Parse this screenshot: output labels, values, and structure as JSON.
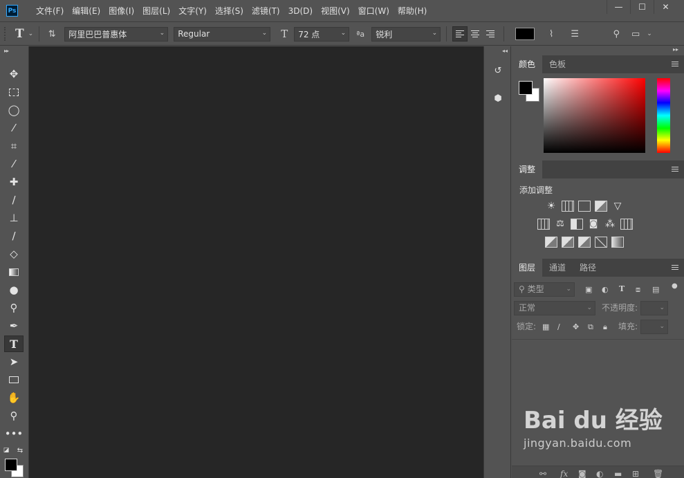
{
  "app": {
    "logo": "Ps"
  },
  "menu": [
    "文件(F)",
    "编辑(E)",
    "图像(I)",
    "图层(L)",
    "文字(Y)",
    "选择(S)",
    "滤镜(T)",
    "3D(D)",
    "视图(V)",
    "窗口(W)",
    "帮助(H)"
  ],
  "window_controls": {
    "minimize": "—",
    "maximize": "☐",
    "close": "✕"
  },
  "options": {
    "tool_glyph": "T",
    "font_family": "阿里巴巴普惠体",
    "font_style": "Regular",
    "font_size": "72 点",
    "antialias_prefix": "ªa",
    "antialias": "锐利",
    "text_color": "#000000"
  },
  "panels": {
    "color": {
      "tabs": [
        "颜色",
        "色板"
      ],
      "foreground": "#000000",
      "background": "#ffffff"
    },
    "adjustments": {
      "tab": "调整",
      "title": "添加调整"
    },
    "layers": {
      "tabs": [
        "图层",
        "通道",
        "路径"
      ],
      "filter_placeholder": "类型",
      "blend_mode": "正常",
      "opacity_label": "不透明度:",
      "lock_label": "锁定:",
      "fill_label": "填充:"
    }
  },
  "watermark": {
    "brand": "Bai du 经验",
    "url": "jingyan.baidu.com"
  }
}
